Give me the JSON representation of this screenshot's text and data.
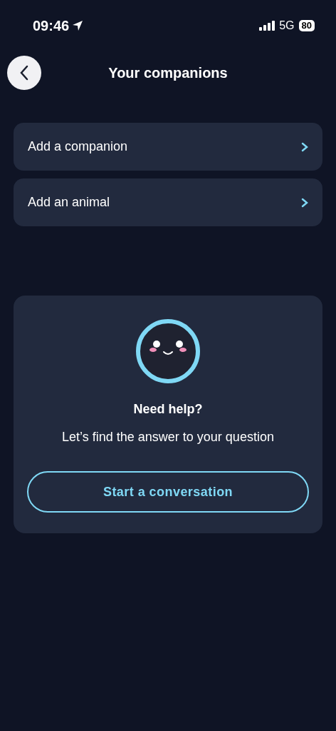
{
  "status_bar": {
    "time": "09:46",
    "network": "5G",
    "battery": "80"
  },
  "header": {
    "title": "Your companions"
  },
  "menu_items": [
    {
      "label": "Add a companion"
    },
    {
      "label": "Add an animal"
    }
  ],
  "help_card": {
    "title": "Need help?",
    "subtitle": "Let’s find the answer to your question",
    "button": "Start a conversation"
  }
}
